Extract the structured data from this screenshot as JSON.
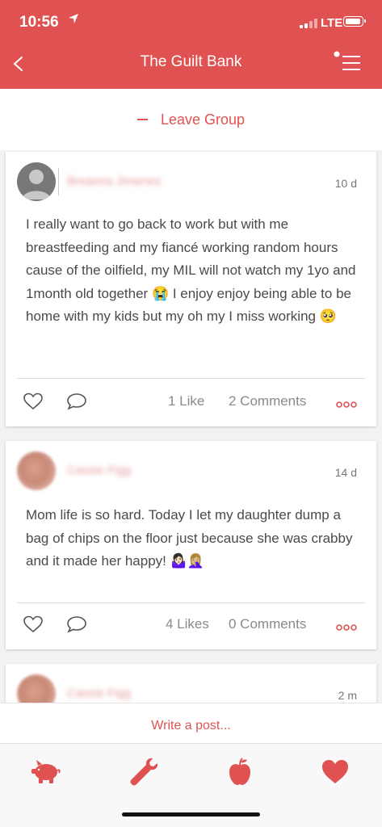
{
  "status": {
    "time": "10:56",
    "network": "LTE"
  },
  "nav": {
    "title": "The Guilt Bank",
    "back_icon": "chevron-left-icon",
    "menu_icon": "menu-icon"
  },
  "group": {
    "leave_label": "Leave Group"
  },
  "posts": [
    {
      "author": "Breanna Jimenez",
      "age": "10 d",
      "text": "I really want to go back to work but with me breastfeeding and my fiancé working random hours cause of the oilfield, my MIL will not watch my 1yo and 1month old together 😭 I enjoy enjoy being able to be home with my kids but my oh my I miss working 🥺",
      "likes": "1 Like",
      "comments": "2 Comments"
    },
    {
      "author": "Cassie Figg",
      "age": "14 d",
      "text": "Mom life is so hard. Today I let my daughter dump a bag of chips on the floor just because she was crabby and it made her happy! 🤷🏻‍♀️🤦🏼‍♀️",
      "likes": "4 Likes",
      "comments": "0 Comments"
    },
    {
      "author": "Cassie Figg",
      "age": "2 m"
    }
  ],
  "composer": {
    "placeholder": "Write a post..."
  },
  "tabs": [
    {
      "icon": "piggy-bank-icon"
    },
    {
      "icon": "wrench-icon"
    },
    {
      "icon": "apple-icon"
    },
    {
      "icon": "heart-icon"
    }
  ],
  "colors": {
    "accent": "#e05252",
    "background": "#f2f2f2"
  }
}
